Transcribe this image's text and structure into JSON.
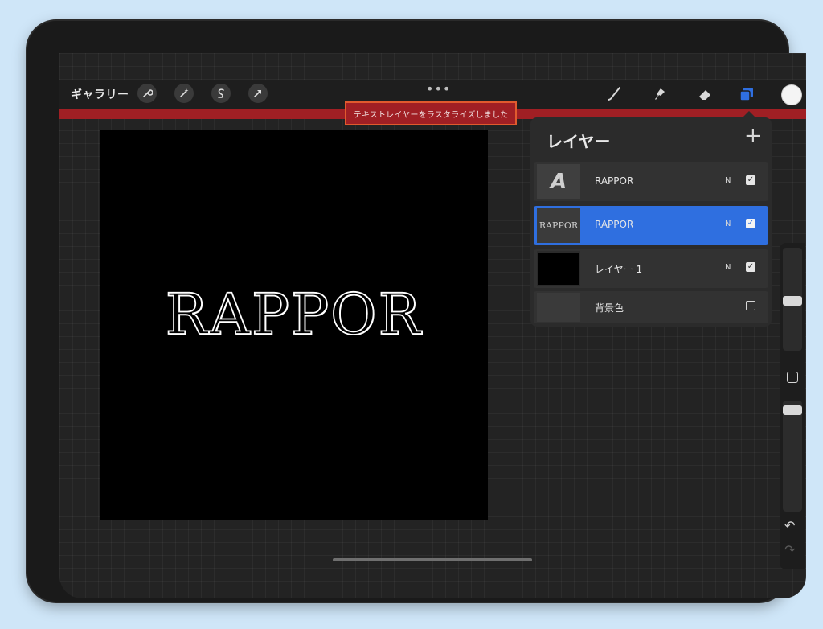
{
  "toolbar": {
    "gallery_label": "ギャラリー",
    "left_tools": [
      {
        "name": "wrench-icon",
        "glyph": "🔧"
      },
      {
        "name": "magic-wand-icon",
        "glyph": "✨"
      },
      {
        "name": "selection-icon",
        "glyph": "S"
      },
      {
        "name": "transform-arrow-icon",
        "glyph": "➚"
      }
    ],
    "menu_dots": "•••",
    "right_tools": [
      {
        "name": "brush-icon",
        "glyph": "✎"
      },
      {
        "name": "smudge-icon",
        "glyph": "✋"
      },
      {
        "name": "eraser-icon",
        "glyph": "⌫"
      },
      {
        "name": "layers-icon",
        "glyph": "❐"
      }
    ],
    "active_color": "#f4f4f4",
    "layers_icon_color": "#2f6fe0"
  },
  "notification": {
    "text": "テキストレイヤーをラスタライズしました",
    "bar_color": "#a01f24",
    "highlight_color": "#e05a2e"
  },
  "canvas": {
    "text": "RAPPOR",
    "background": "#000000"
  },
  "layers_panel": {
    "title": "レイヤー",
    "add_label": "+",
    "layers": [
      {
        "name": "RAPPOR",
        "mode": "N",
        "visible": true,
        "selected": false,
        "thumb": "A"
      },
      {
        "name": "RAPPOR",
        "mode": "N",
        "visible": true,
        "selected": true,
        "thumb": "RAPPOR"
      },
      {
        "name": "レイヤー 1",
        "mode": "N",
        "visible": true,
        "selected": false,
        "thumb": ""
      },
      {
        "name": "背景色",
        "mode": "",
        "visible": false,
        "selected": false,
        "thumb": ""
      }
    ]
  },
  "sidebar": {
    "undo_glyph": "↶",
    "redo_glyph": "↷"
  }
}
